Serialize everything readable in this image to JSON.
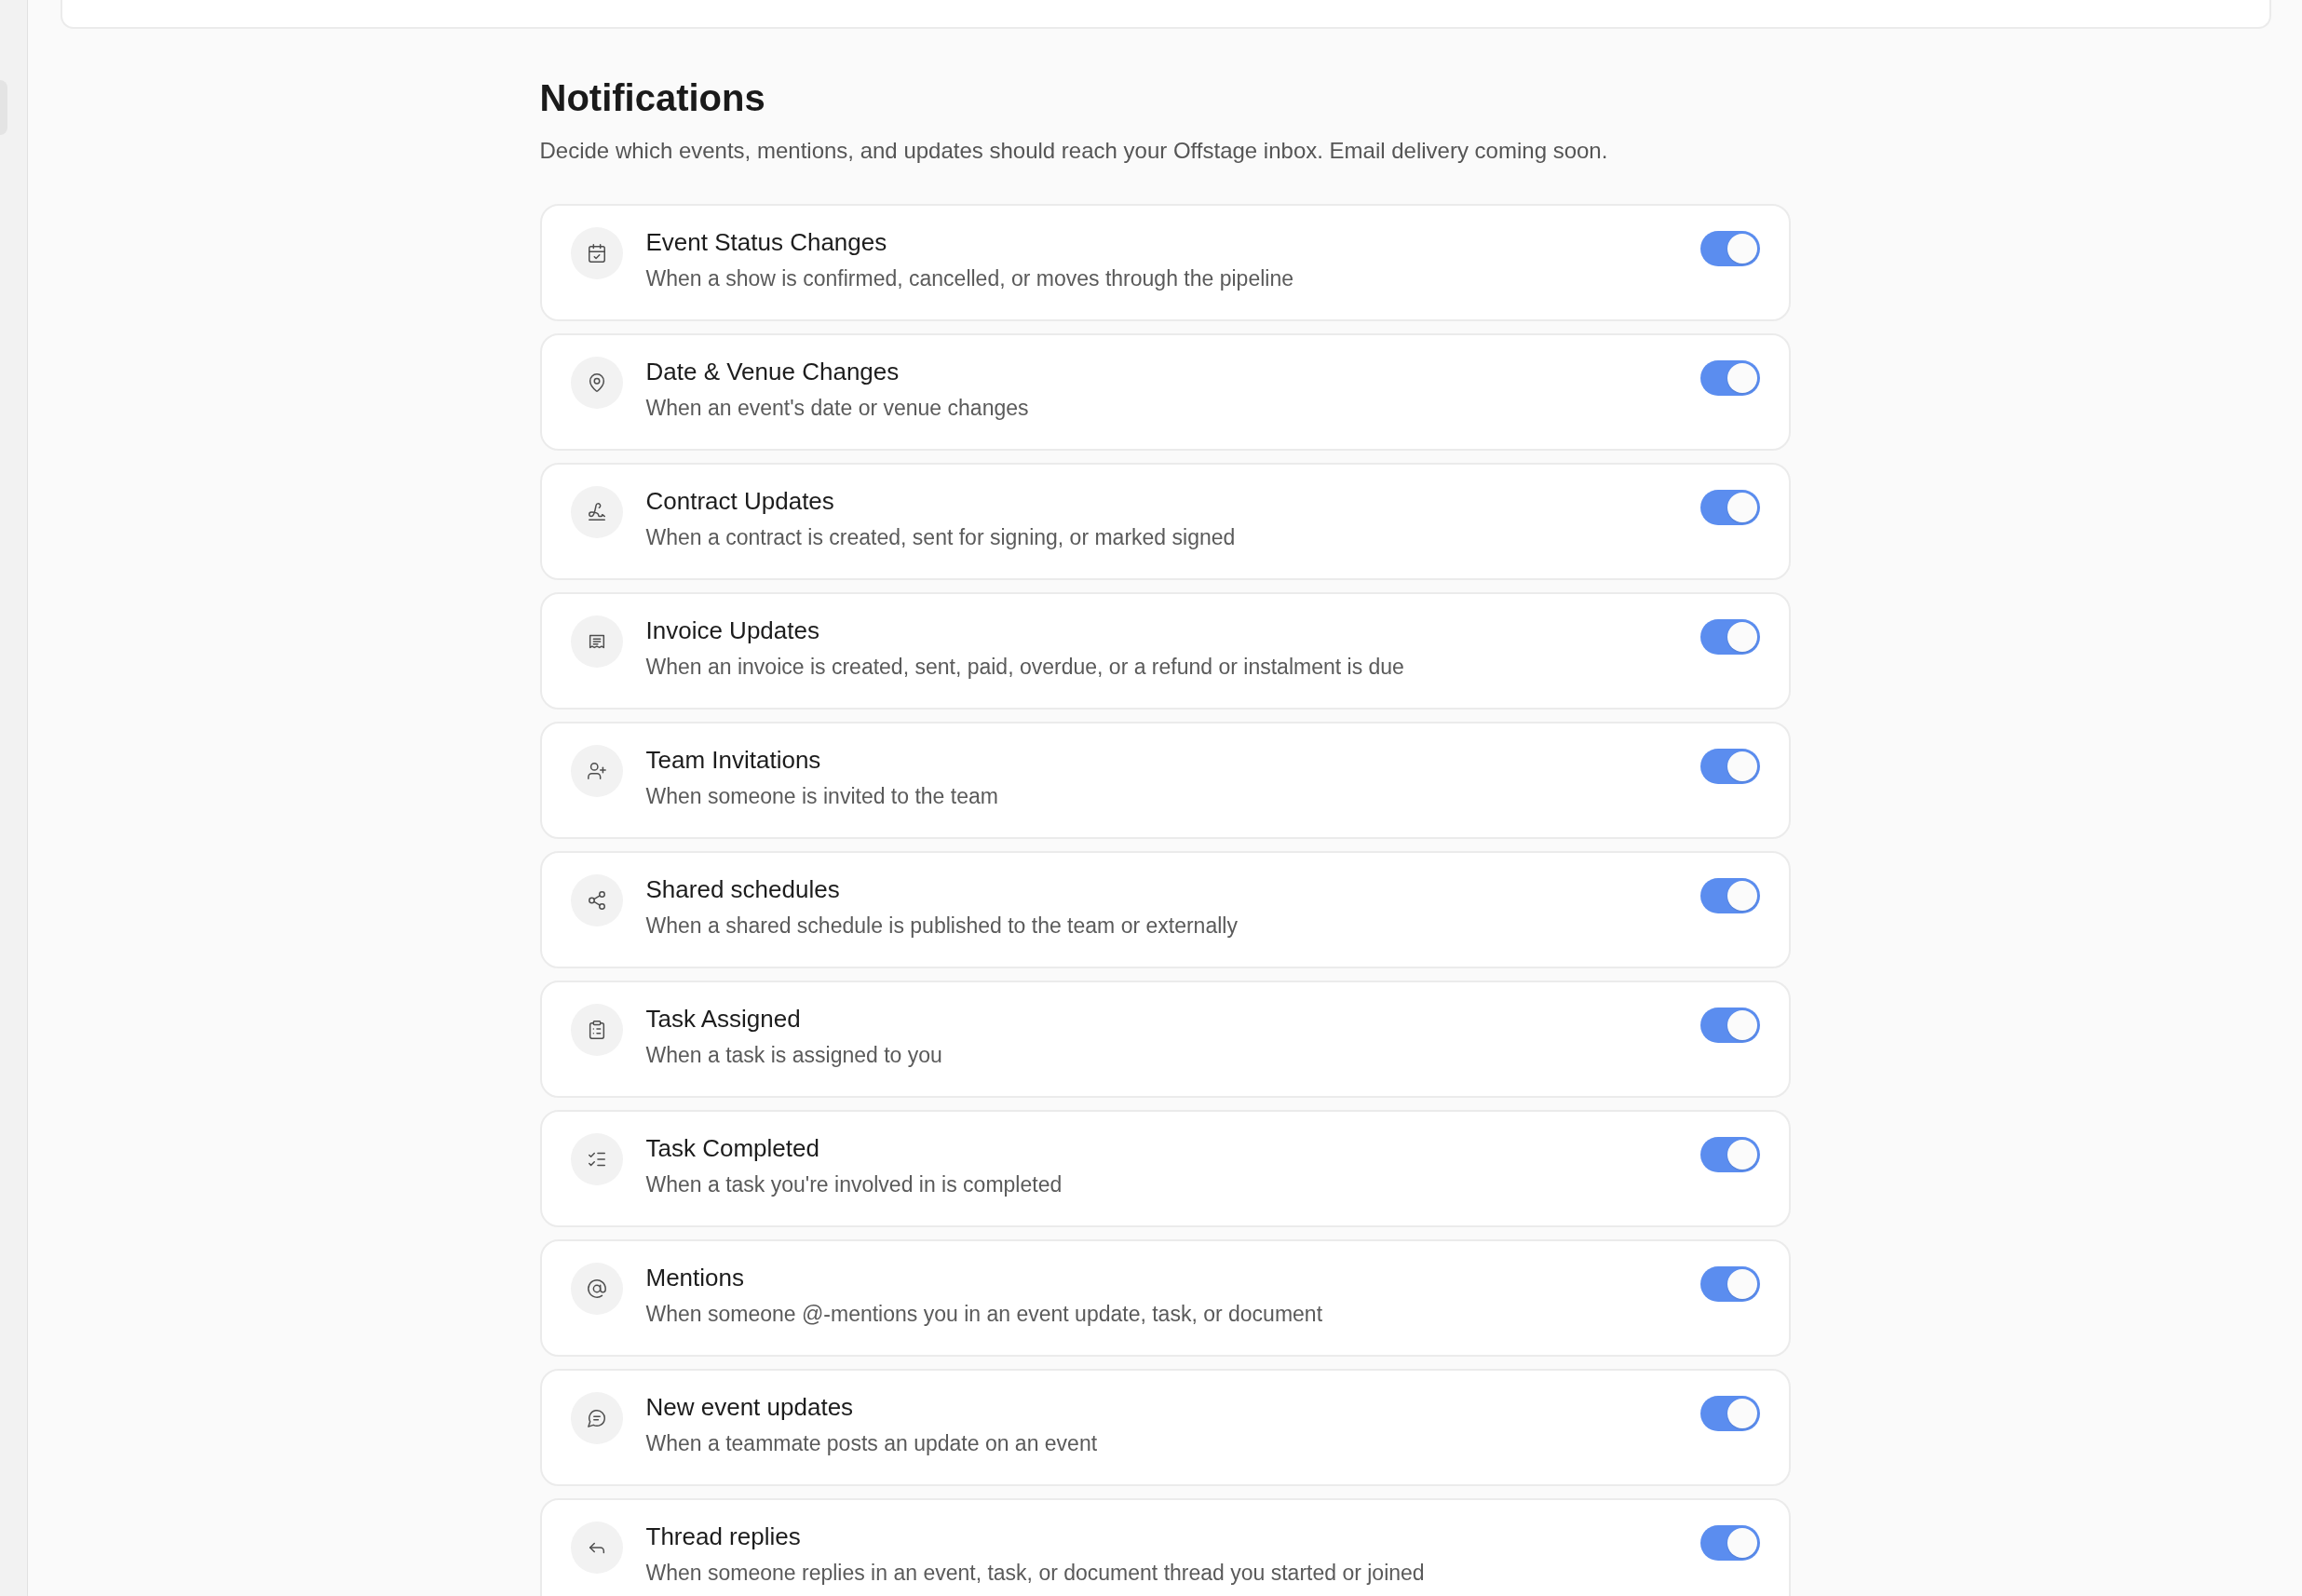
{
  "page": {
    "title": "Notifications",
    "subtitle": "Decide which events, mentions, and updates should reach your Offstage inbox. Email delivery coming soon."
  },
  "notifications": [
    {
      "title": "Event Status Changes",
      "description": "When a show is confirmed, cancelled, or moves through the pipeline",
      "on": true
    },
    {
      "title": "Date & Venue Changes",
      "description": "When an event's date or venue changes",
      "on": true
    },
    {
      "title": "Contract Updates",
      "description": "When a contract is created, sent for signing, or marked signed",
      "on": true
    },
    {
      "title": "Invoice Updates",
      "description": "When an invoice is created, sent, paid, overdue, or a refund or instalment is due",
      "on": true
    },
    {
      "title": "Team Invitations",
      "description": "When someone is invited to the team",
      "on": true
    },
    {
      "title": "Shared schedules",
      "description": "When a shared schedule is published to the team or externally",
      "on": true
    },
    {
      "title": "Task Assigned",
      "description": "When a task is assigned to you",
      "on": true
    },
    {
      "title": "Task Completed",
      "description": "When a task you're involved in is completed",
      "on": true
    },
    {
      "title": "Mentions",
      "description": "When someone @-mentions you in an event update, task, or document",
      "on": true
    },
    {
      "title": "New event updates",
      "description": "When a teammate posts an update on an event",
      "on": true
    },
    {
      "title": "Thread replies",
      "description": "When someone replies in an event, task, or document thread you started or joined",
      "on": true
    }
  ]
}
